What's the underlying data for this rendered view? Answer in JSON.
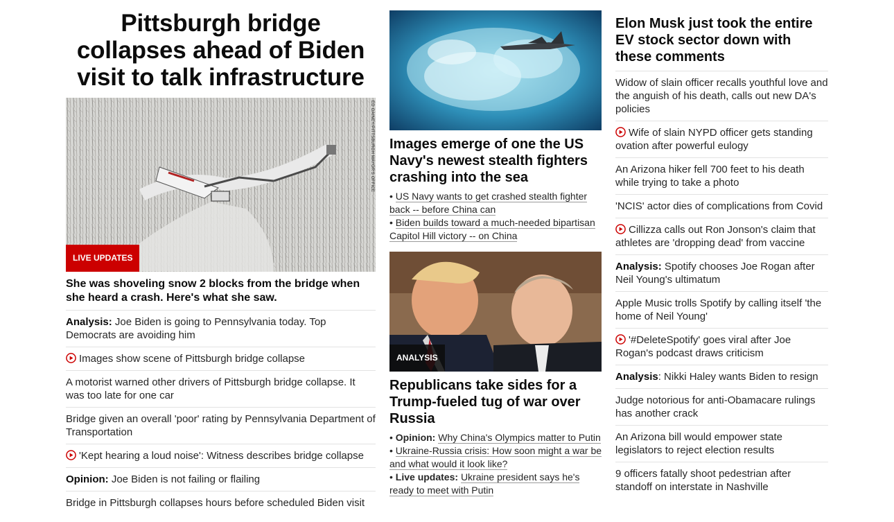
{
  "col1": {
    "headline": "Pittsburgh bridge collapses ahead of Biden visit to talk infrastructure",
    "image_credit": "ED GAINEY/PITTSBURGH MAYOR'S OFFICE",
    "badge": "LIVE UPDATES",
    "lead": "She was shoveling snow 2 blocks from the bridge when she heard a crash. Here's what she saw.",
    "items": [
      {
        "prefix": "Analysis:",
        "text": " Joe Biden is going to Pennsylvania today. Top Democrats are avoiding him"
      },
      {
        "text": "Images show scene of Pittsburgh bridge collapse",
        "video": true
      },
      {
        "text": "A motorist warned other drivers of Pittsburgh bridge collapse. It was too late for one car"
      },
      {
        "text": "Bridge given an overall 'poor' rating by Pennsylvania Department of Transportation"
      },
      {
        "text": "'Kept hearing a loud noise': Witness describes bridge collapse",
        "video": true
      },
      {
        "prefix": "Opinion:",
        "text": " Joe Biden is not failing or flailing"
      },
      {
        "text": "Bridge in Pittsburgh collapses hours before scheduled Biden visit"
      }
    ]
  },
  "col2": {
    "story1": {
      "headline": "Images emerge of one the US Navy's newest stealth fighters crashing into the sea",
      "links": [
        "US Navy wants to get crashed stealth fighter back -- before China can",
        "Biden builds toward a much-needed bipartisan Capitol Hill victory -- on China"
      ]
    },
    "story2": {
      "badge": "ANALYSIS",
      "headline": "Republicans take sides for a Trump-fueled tug of war over Russia",
      "links": [
        {
          "prefix": "Opinion:",
          "text": "Why China's Olympics matter to Putin"
        },
        {
          "prefix": "",
          "text": "Ukraine-Russia crisis: How soon might a war be and what would it look like?"
        },
        {
          "prefix": "Live updates:",
          "text": "Ukraine president says he's ready to meet with Putin"
        }
      ]
    }
  },
  "col3": {
    "headline": "Elon Musk just took the entire EV stock sector down with these comments",
    "items": [
      {
        "text": "Widow of slain officer recalls youthful love and the anguish of his death, calls out new DA's policies"
      },
      {
        "text": "Wife of slain NYPD officer gets standing ovation after powerful eulogy",
        "video": true
      },
      {
        "text": "An Arizona hiker fell 700 feet to his death while trying to take a photo"
      },
      {
        "text": "'NCIS' actor dies of complications from Covid"
      },
      {
        "text": "Cillizza calls out Ron Jonson's claim that athletes are 'dropping dead' from vaccine",
        "video": true
      },
      {
        "prefix": "Analysis:",
        "text": " Spotify chooses Joe Rogan after Neil Young's ultimatum"
      },
      {
        "text": "Apple Music trolls Spotify by calling itself 'the home of Neil Young'"
      },
      {
        "text": "'#DeleteSpotify' goes viral after Joe Rogan's podcast draws criticism",
        "video": true
      },
      {
        "prefix": "Analysis",
        "text": ": Nikki Haley wants Biden to resign"
      },
      {
        "text": "Judge notorious for anti-Obamacare rulings has another crack"
      },
      {
        "text": "An Arizona bill would empower state legislators to reject election results"
      },
      {
        "text": "9 officers fatally shoot pedestrian after standoff on interstate in Nashville"
      }
    ]
  },
  "colors": {
    "accent_red": "#cc0000",
    "text": "#0c0c0c",
    "divider": "#e2e2e2"
  },
  "icons": {
    "video": "play-circle-icon"
  }
}
